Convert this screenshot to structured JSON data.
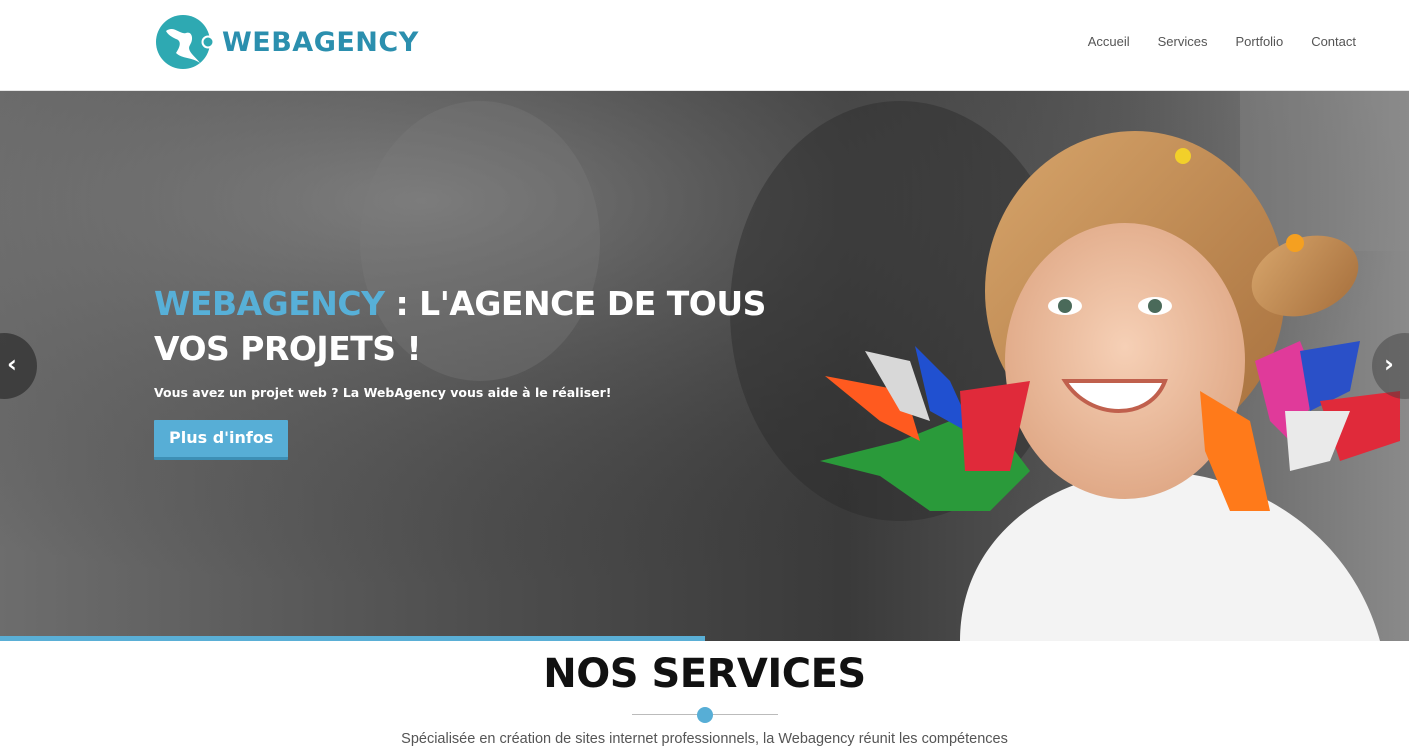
{
  "header": {
    "logo_text": "WEBAGENCY",
    "nav": [
      "Accueil",
      "Services",
      "Portfolio",
      "Contact"
    ]
  },
  "hero": {
    "title_accent": "WEBAGENCY",
    "title_rest": " : L'AGENCE DE TOUS",
    "title_line2": "VOS PROJETS !",
    "subtitle": "Vous avez un projet web ? La WebAgency vous aide à le réaliser!",
    "button_label": "Plus d'infos",
    "prev_icon": "chevron-left-icon",
    "next_icon": "chevron-right-icon",
    "slide_progress_percent": 50
  },
  "services": {
    "title": "NOS SERVICES",
    "description": "Spécialisée en création de sites internet professionnels, la Webagency réunit les compétences"
  },
  "colors": {
    "brand": "#2b8fae",
    "accent": "#57aed6",
    "text_dark": "#111111"
  }
}
